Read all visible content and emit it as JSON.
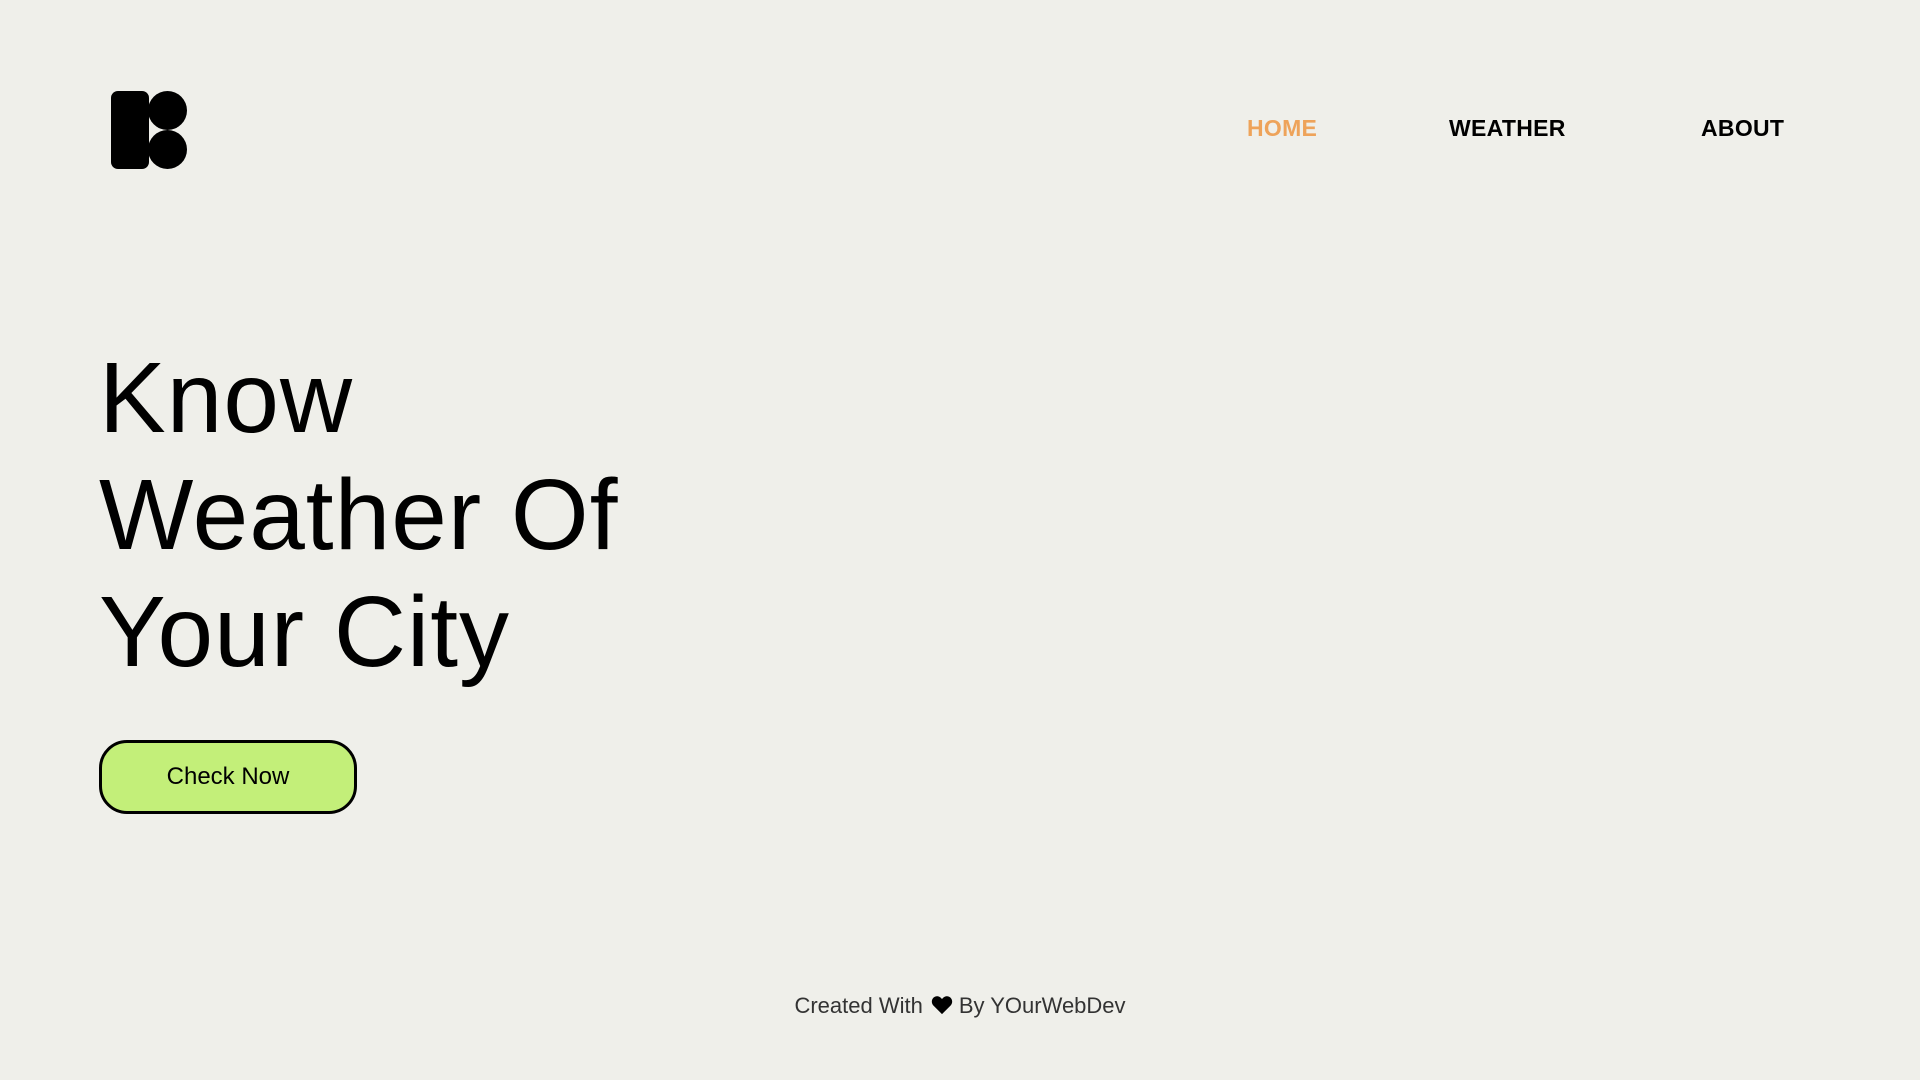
{
  "brand": {
    "logo_icon": "logo-mark-icon"
  },
  "nav": {
    "items": [
      {
        "label": "HOME",
        "active": true
      },
      {
        "label": "WEATHER",
        "active": false
      },
      {
        "label": "ABOUT",
        "active": false
      }
    ],
    "active_color": "#eea35a"
  },
  "hero": {
    "lines": [
      "Know",
      "Weather Of",
      "Your City"
    ]
  },
  "cta": {
    "label": "Check Now",
    "color": "#c3ef79"
  },
  "footer": {
    "prefix": "Created With",
    "icon": "heart-icon",
    "suffix": "By YOurWebDev"
  },
  "colors": {
    "background": "#efefea",
    "text": "#000000"
  }
}
